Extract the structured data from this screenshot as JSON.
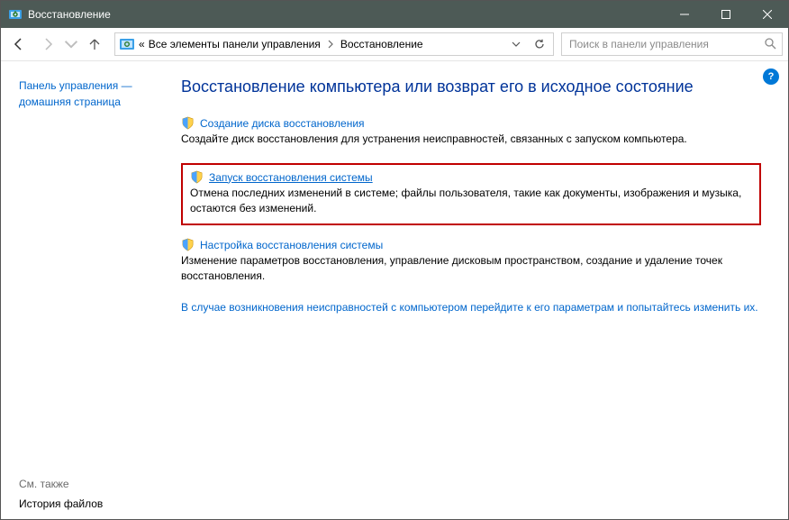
{
  "window": {
    "title": "Восстановление"
  },
  "nav": {
    "breadcrumb_prefix": "«",
    "crumb1": "Все элементы панели управления",
    "crumb2": "Восстановление"
  },
  "search": {
    "placeholder": "Поиск в панели управления"
  },
  "sidebar": {
    "link1_line1": "Панель управления —",
    "link1_line2": "домашняя страница",
    "see_also": "См. также",
    "history": "История файлов"
  },
  "content": {
    "title": "Восстановление компьютера или возврат его в исходное состояние",
    "sec1": {
      "link": "Создание диска восстановления",
      "desc": "Создайте диск восстановления для устранения неисправностей, связанных с запуском компьютера."
    },
    "sec2": {
      "link": "Запуск восстановления системы",
      "desc": "Отмена последних изменений в системе; файлы пользователя, такие как документы, изображения и музыка, остаются без изменений."
    },
    "sec3": {
      "link": "Настройка восстановления системы",
      "desc": "Изменение параметров восстановления, управление дисковым пространством, создание и удаление точек восстановления."
    },
    "bottom_link": "В случае возникновения неисправностей с компьютером перейдите к его параметрам и попытайтесь изменить их."
  },
  "help_badge": "?"
}
